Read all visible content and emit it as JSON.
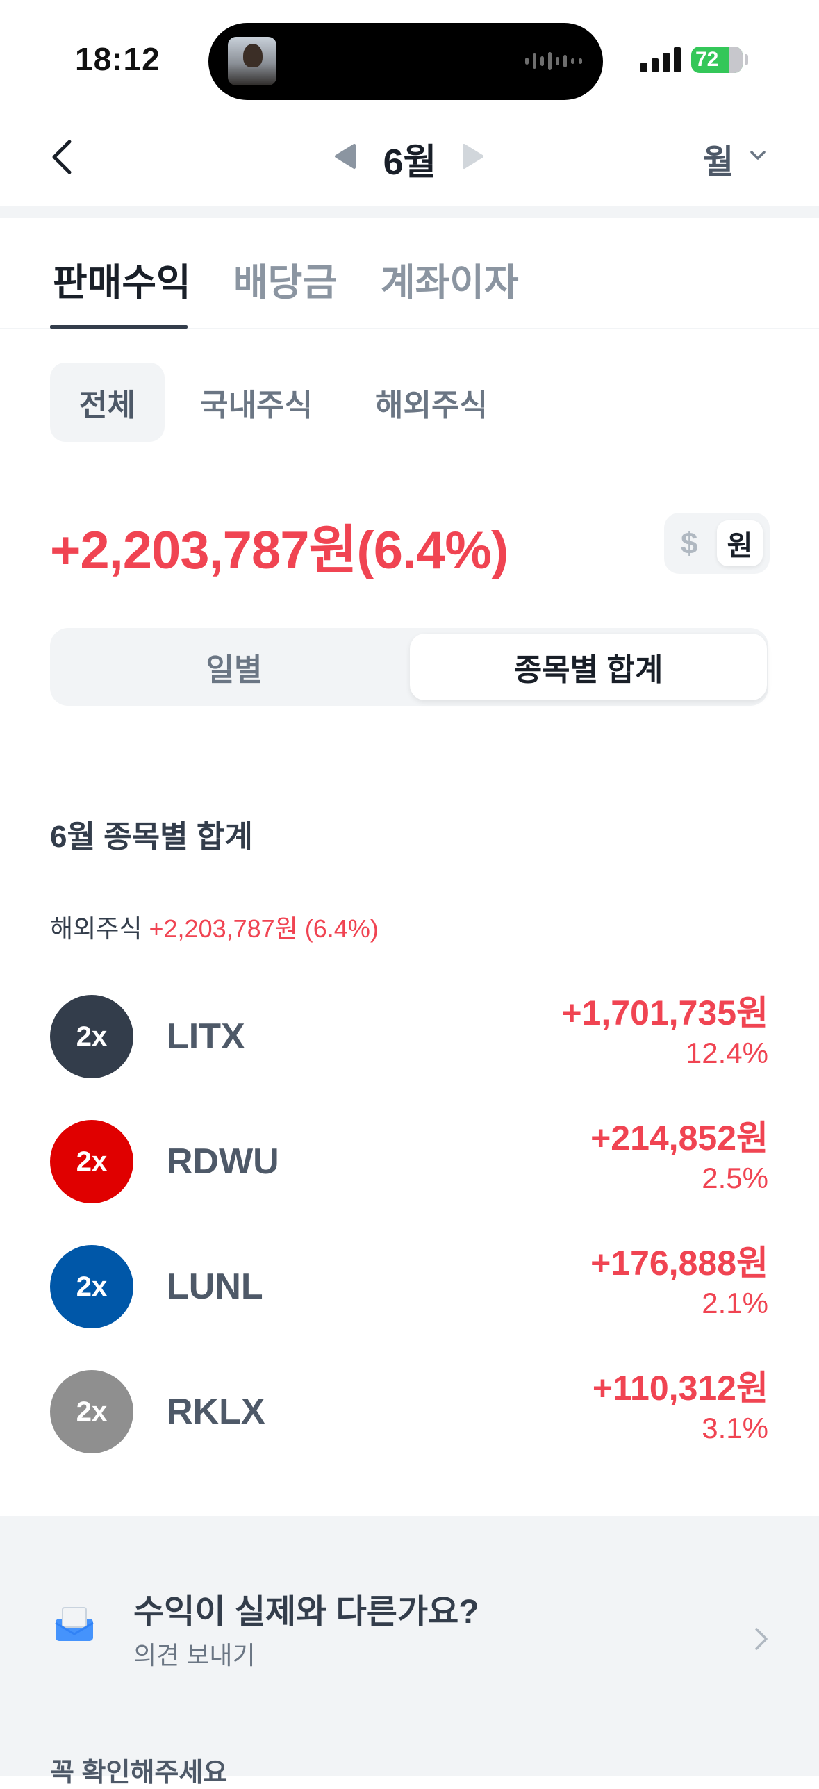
{
  "status_bar": {
    "time": "18:12",
    "battery": "72"
  },
  "header": {
    "month": "6월",
    "period": "월"
  },
  "main_tabs": [
    {
      "label": "판매수익",
      "active": true
    },
    {
      "label": "배당금",
      "active": false
    },
    {
      "label": "계좌이자",
      "active": false
    }
  ],
  "market_chips": [
    {
      "label": "전체",
      "active": true
    },
    {
      "label": "국내주식",
      "active": false
    },
    {
      "label": "해외주식",
      "active": false
    }
  ],
  "summary": {
    "total": "+2,203,787원(6.4%)",
    "currency_usd": "$",
    "currency_krw": "원"
  },
  "view_toggle": {
    "daily": "일별",
    "by_stock": "종목별 합계"
  },
  "section": {
    "title": "6월 종목별 합계",
    "group_label": "해외주식",
    "group_value": "+2,203,787원 (6.4%)"
  },
  "stocks": [
    {
      "badge": "2x",
      "ticker": "LITX",
      "amount": "+1,701,735원",
      "percent": "12.4%",
      "color": "#333d4b"
    },
    {
      "badge": "2x",
      "ticker": "RDWU",
      "amount": "+214,852원",
      "percent": "2.5%",
      "color": "#e00000"
    },
    {
      "badge": "2x",
      "ticker": "LUNL",
      "amount": "+176,888원",
      "percent": "2.1%",
      "color": "#0057a8"
    },
    {
      "badge": "2x",
      "ticker": "RKLX",
      "amount": "+110,312원",
      "percent": "3.1%",
      "color": "#8f8f8f"
    }
  ],
  "feedback": {
    "title": "수익이 실제와 다른가요?",
    "subtitle": "의견 보내기"
  },
  "notice": "꼭 확인해주세요",
  "colors": {
    "positive": "#f04452",
    "text": "#333d4b",
    "muted": "#8b95a1",
    "surface": "#f2f4f6"
  }
}
